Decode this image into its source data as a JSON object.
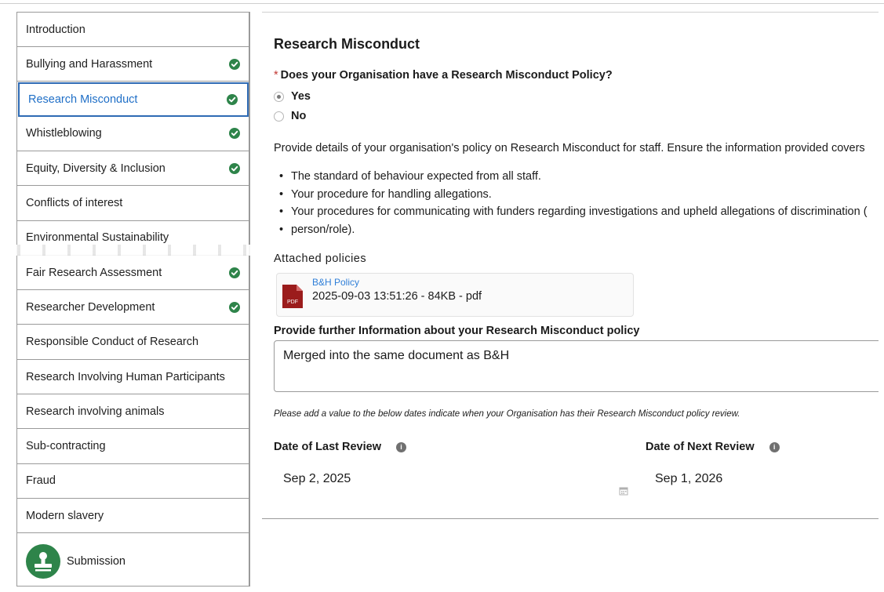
{
  "nav": {
    "items": [
      {
        "label": "Introduction",
        "complete": false,
        "active": false
      },
      {
        "label": "Bullying and Harassment",
        "complete": true,
        "active": false
      },
      {
        "label": "Research Misconduct",
        "complete": true,
        "active": true
      },
      {
        "label": "Whistleblowing",
        "complete": true,
        "active": false
      },
      {
        "label": "Equity, Diversity & Inclusion",
        "complete": true,
        "active": false
      },
      {
        "label": "Conflicts of interest",
        "complete": false,
        "active": false
      },
      {
        "label": "Environmental Sustainability",
        "complete": false,
        "active": false
      },
      {
        "label": "Fair Research Assessment",
        "complete": true,
        "active": false
      },
      {
        "label": "Researcher Development",
        "complete": true,
        "active": false
      },
      {
        "label": "Responsible Conduct of Research",
        "complete": false,
        "active": false
      },
      {
        "label": "Research Involving Human Participants",
        "complete": false,
        "active": false
      },
      {
        "label": "Research involving animals",
        "complete": false,
        "active": false
      },
      {
        "label": "Sub-contracting",
        "complete": false,
        "active": false
      },
      {
        "label": "Fraud",
        "complete": false,
        "active": false
      },
      {
        "label": "Modern slavery",
        "complete": false,
        "active": false
      }
    ],
    "submission_label": "Submission"
  },
  "main": {
    "title": "Research Misconduct",
    "question": "Does your Organisation have a Research Misconduct Policy?",
    "required_mark": "*",
    "options": [
      {
        "label": "Yes",
        "selected": true
      },
      {
        "label": "No",
        "selected": false
      }
    ],
    "details_text": "Provide details of your organisation's policy on Research Misconduct for staff. Ensure the information provided covers",
    "bullets": [
      "The standard of behaviour expected from all staff.",
      "Your procedure for handling allegations.",
      "Your procedures for communicating with funders regarding investigations and upheld allegations of discrimination (",
      "person/role)."
    ],
    "attached_label": "Attached policies",
    "file": {
      "name": "B&H Policy",
      "meta": "2025-09-03 13:51:26 - 84KB - pdf",
      "icon_text": "PDF"
    },
    "further_info_label": "Provide further Information about your Research Misconduct policy",
    "further_info_value": "Merged into the same document as B&H",
    "dates_hint": "Please add a value to the below dates indicate when your Organisation has their Research Misconduct policy review.",
    "last_review_label": "Date of Last Review",
    "last_review_value": "Sep 2, 2025",
    "next_review_label": "Date of Next Review",
    "next_review_value": "Sep 1, 2026",
    "info_icon_glyph": "i"
  },
  "colors": {
    "accent": "#2f6bb4",
    "link": "#1f6fc7",
    "success": "#2e844a",
    "required": "#c23934",
    "pdf": "#9b1c1c"
  }
}
